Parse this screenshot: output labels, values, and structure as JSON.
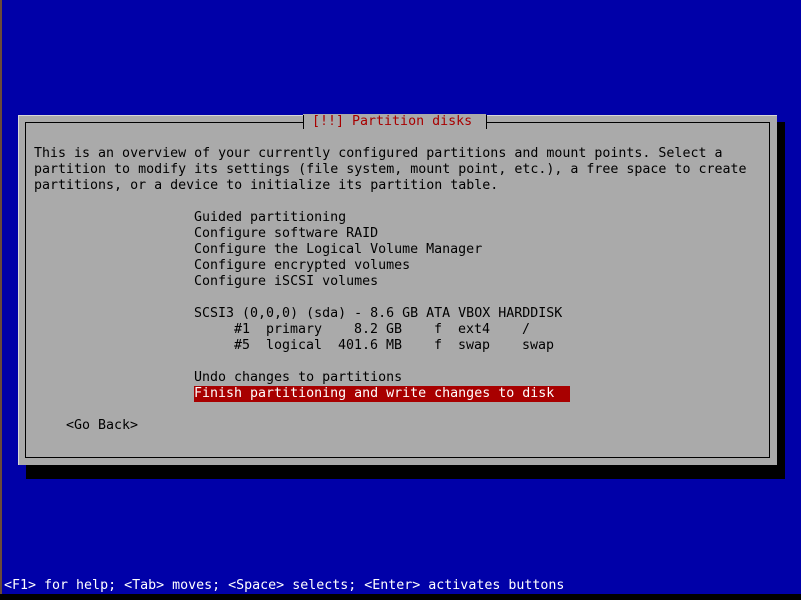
{
  "dialog": {
    "title": "[!!] Partition disks",
    "description": [
      "This is an overview of your currently configured partitions and mount points. Select a",
      "partition to modify its settings (file system, mount point, etc.), a free space to create",
      "partitions, or a device to initialize its partition table."
    ],
    "menu_items": [
      "Guided partitioning",
      "Configure software RAID",
      "Configure the Logical Volume Manager",
      "Configure encrypted volumes",
      "Configure iSCSI volumes"
    ],
    "disk": {
      "label": "SCSI3 (0,0,0) (sda) - 8.6 GB ATA VBOX HARDDISK",
      "partitions": [
        {
          "number": "#1",
          "type": "primary",
          "size": "8.2 GB",
          "flag": "f",
          "filesystem": "ext4",
          "mount": "/"
        },
        {
          "number": "#5",
          "type": "logical",
          "size": "401.6 MB",
          "flag": "f",
          "filesystem": "swap",
          "mount": "swap"
        }
      ]
    },
    "actions": [
      {
        "label": "Undo changes to partitions",
        "selected": false
      },
      {
        "label": "Finish partitioning and write changes to disk",
        "selected": true
      }
    ],
    "go_back_label": "<Go Back>"
  },
  "help_line": "<F1> for help; <Tab> moves; <Space> selects; <Enter> activates buttons",
  "colors": {
    "screen_bg": "#0000a8",
    "dialog_bg": "#aaaaaa",
    "title_color": "#a80000",
    "selection_bg": "#a80000",
    "selection_fg": "#ffffff"
  }
}
